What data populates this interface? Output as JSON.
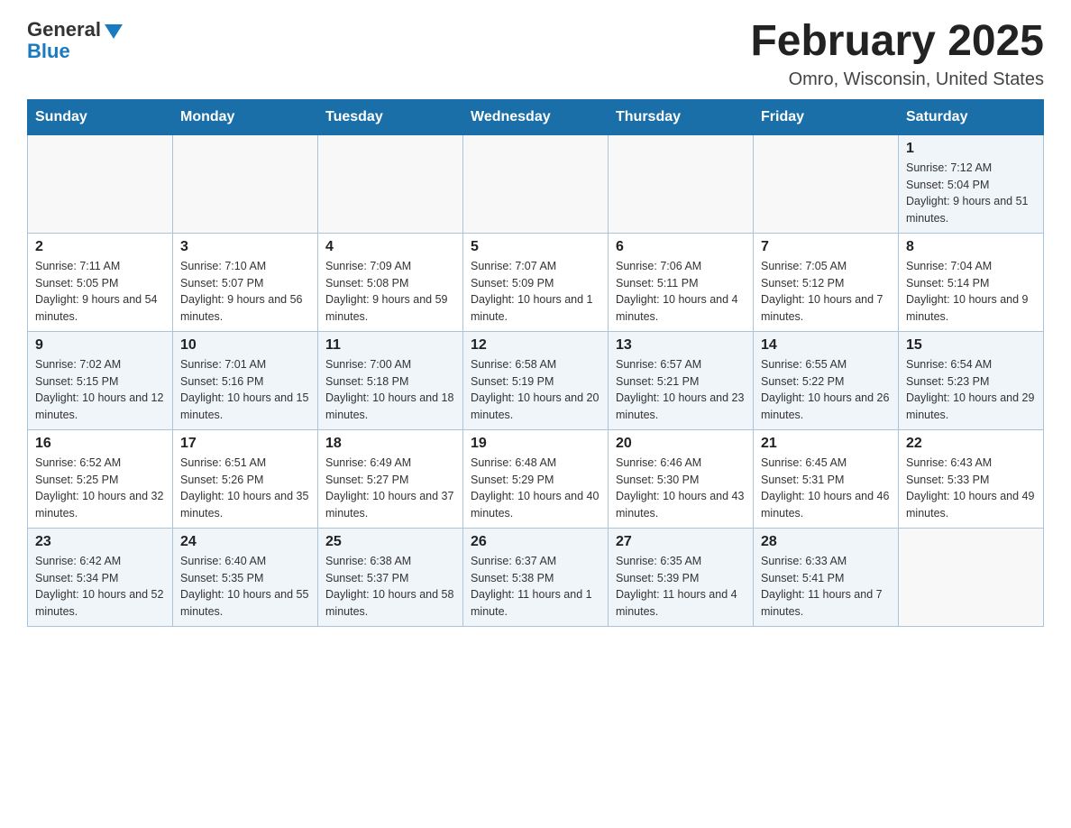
{
  "logo": {
    "general": "General",
    "blue": "Blue"
  },
  "header": {
    "month_year": "February 2025",
    "location": "Omro, Wisconsin, United States"
  },
  "days_of_week": [
    "Sunday",
    "Monday",
    "Tuesday",
    "Wednesday",
    "Thursday",
    "Friday",
    "Saturday"
  ],
  "weeks": [
    [
      {
        "day": "",
        "sunrise": "",
        "sunset": "",
        "daylight": ""
      },
      {
        "day": "",
        "sunrise": "",
        "sunset": "",
        "daylight": ""
      },
      {
        "day": "",
        "sunrise": "",
        "sunset": "",
        "daylight": ""
      },
      {
        "day": "",
        "sunrise": "",
        "sunset": "",
        "daylight": ""
      },
      {
        "day": "",
        "sunrise": "",
        "sunset": "",
        "daylight": ""
      },
      {
        "day": "",
        "sunrise": "",
        "sunset": "",
        "daylight": ""
      },
      {
        "day": "1",
        "sunrise": "Sunrise: 7:12 AM",
        "sunset": "Sunset: 5:04 PM",
        "daylight": "Daylight: 9 hours and 51 minutes."
      }
    ],
    [
      {
        "day": "2",
        "sunrise": "Sunrise: 7:11 AM",
        "sunset": "Sunset: 5:05 PM",
        "daylight": "Daylight: 9 hours and 54 minutes."
      },
      {
        "day": "3",
        "sunrise": "Sunrise: 7:10 AM",
        "sunset": "Sunset: 5:07 PM",
        "daylight": "Daylight: 9 hours and 56 minutes."
      },
      {
        "day": "4",
        "sunrise": "Sunrise: 7:09 AM",
        "sunset": "Sunset: 5:08 PM",
        "daylight": "Daylight: 9 hours and 59 minutes."
      },
      {
        "day": "5",
        "sunrise": "Sunrise: 7:07 AM",
        "sunset": "Sunset: 5:09 PM",
        "daylight": "Daylight: 10 hours and 1 minute."
      },
      {
        "day": "6",
        "sunrise": "Sunrise: 7:06 AM",
        "sunset": "Sunset: 5:11 PM",
        "daylight": "Daylight: 10 hours and 4 minutes."
      },
      {
        "day": "7",
        "sunrise": "Sunrise: 7:05 AM",
        "sunset": "Sunset: 5:12 PM",
        "daylight": "Daylight: 10 hours and 7 minutes."
      },
      {
        "day": "8",
        "sunrise": "Sunrise: 7:04 AM",
        "sunset": "Sunset: 5:14 PM",
        "daylight": "Daylight: 10 hours and 9 minutes."
      }
    ],
    [
      {
        "day": "9",
        "sunrise": "Sunrise: 7:02 AM",
        "sunset": "Sunset: 5:15 PM",
        "daylight": "Daylight: 10 hours and 12 minutes."
      },
      {
        "day": "10",
        "sunrise": "Sunrise: 7:01 AM",
        "sunset": "Sunset: 5:16 PM",
        "daylight": "Daylight: 10 hours and 15 minutes."
      },
      {
        "day": "11",
        "sunrise": "Sunrise: 7:00 AM",
        "sunset": "Sunset: 5:18 PM",
        "daylight": "Daylight: 10 hours and 18 minutes."
      },
      {
        "day": "12",
        "sunrise": "Sunrise: 6:58 AM",
        "sunset": "Sunset: 5:19 PM",
        "daylight": "Daylight: 10 hours and 20 minutes."
      },
      {
        "day": "13",
        "sunrise": "Sunrise: 6:57 AM",
        "sunset": "Sunset: 5:21 PM",
        "daylight": "Daylight: 10 hours and 23 minutes."
      },
      {
        "day": "14",
        "sunrise": "Sunrise: 6:55 AM",
        "sunset": "Sunset: 5:22 PM",
        "daylight": "Daylight: 10 hours and 26 minutes."
      },
      {
        "day": "15",
        "sunrise": "Sunrise: 6:54 AM",
        "sunset": "Sunset: 5:23 PM",
        "daylight": "Daylight: 10 hours and 29 minutes."
      }
    ],
    [
      {
        "day": "16",
        "sunrise": "Sunrise: 6:52 AM",
        "sunset": "Sunset: 5:25 PM",
        "daylight": "Daylight: 10 hours and 32 minutes."
      },
      {
        "day": "17",
        "sunrise": "Sunrise: 6:51 AM",
        "sunset": "Sunset: 5:26 PM",
        "daylight": "Daylight: 10 hours and 35 minutes."
      },
      {
        "day": "18",
        "sunrise": "Sunrise: 6:49 AM",
        "sunset": "Sunset: 5:27 PM",
        "daylight": "Daylight: 10 hours and 37 minutes."
      },
      {
        "day": "19",
        "sunrise": "Sunrise: 6:48 AM",
        "sunset": "Sunset: 5:29 PM",
        "daylight": "Daylight: 10 hours and 40 minutes."
      },
      {
        "day": "20",
        "sunrise": "Sunrise: 6:46 AM",
        "sunset": "Sunset: 5:30 PM",
        "daylight": "Daylight: 10 hours and 43 minutes."
      },
      {
        "day": "21",
        "sunrise": "Sunrise: 6:45 AM",
        "sunset": "Sunset: 5:31 PM",
        "daylight": "Daylight: 10 hours and 46 minutes."
      },
      {
        "day": "22",
        "sunrise": "Sunrise: 6:43 AM",
        "sunset": "Sunset: 5:33 PM",
        "daylight": "Daylight: 10 hours and 49 minutes."
      }
    ],
    [
      {
        "day": "23",
        "sunrise": "Sunrise: 6:42 AM",
        "sunset": "Sunset: 5:34 PM",
        "daylight": "Daylight: 10 hours and 52 minutes."
      },
      {
        "day": "24",
        "sunrise": "Sunrise: 6:40 AM",
        "sunset": "Sunset: 5:35 PM",
        "daylight": "Daylight: 10 hours and 55 minutes."
      },
      {
        "day": "25",
        "sunrise": "Sunrise: 6:38 AM",
        "sunset": "Sunset: 5:37 PM",
        "daylight": "Daylight: 10 hours and 58 minutes."
      },
      {
        "day": "26",
        "sunrise": "Sunrise: 6:37 AM",
        "sunset": "Sunset: 5:38 PM",
        "daylight": "Daylight: 11 hours and 1 minute."
      },
      {
        "day": "27",
        "sunrise": "Sunrise: 6:35 AM",
        "sunset": "Sunset: 5:39 PM",
        "daylight": "Daylight: 11 hours and 4 minutes."
      },
      {
        "day": "28",
        "sunrise": "Sunrise: 6:33 AM",
        "sunset": "Sunset: 5:41 PM",
        "daylight": "Daylight: 11 hours and 7 minutes."
      },
      {
        "day": "",
        "sunrise": "",
        "sunset": "",
        "daylight": ""
      }
    ]
  ]
}
